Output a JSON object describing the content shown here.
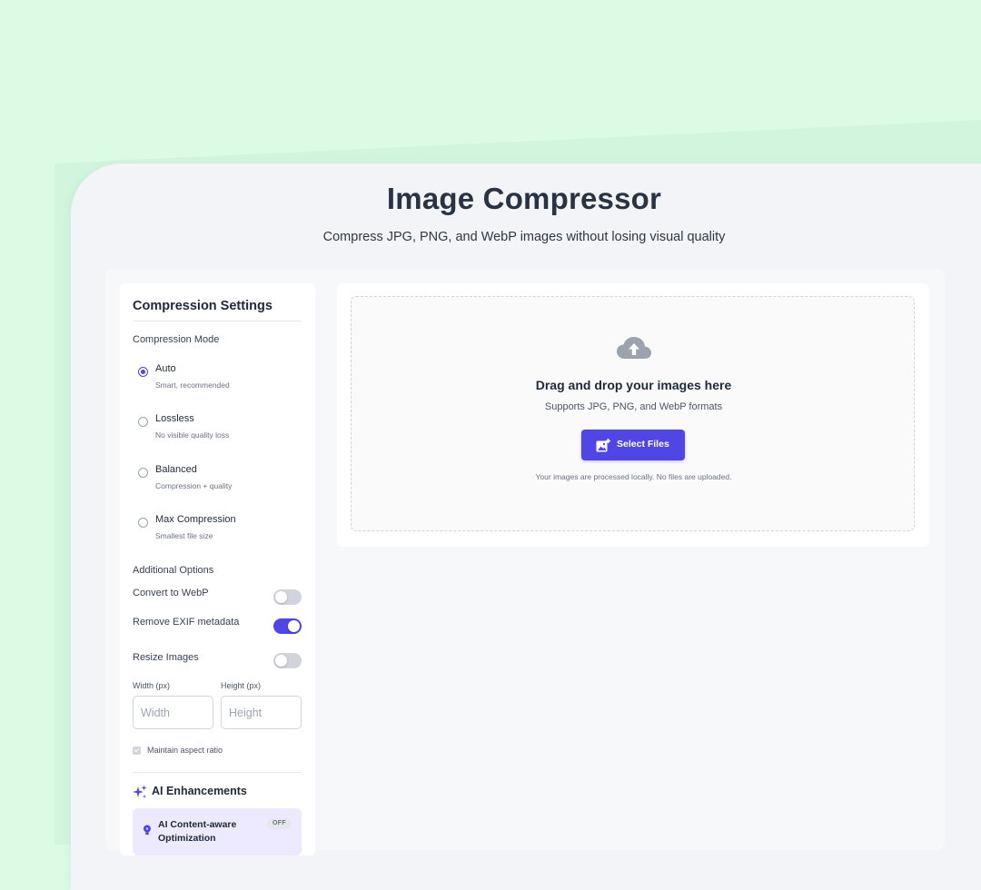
{
  "header": {
    "title": "Image Compressor",
    "subtitle": "Compress JPG, PNG, and WebP images without losing visual quality"
  },
  "colors": {
    "accent": "#4f46e5",
    "background": "#dcfbe4",
    "window": "#f3f4f7"
  },
  "sidebar": {
    "title": "Compression Settings",
    "mode_label": "Compression Mode",
    "modes": [
      {
        "label": "Auto",
        "desc": "Smart, recommended",
        "selected": true
      },
      {
        "label": "Lossless",
        "desc": "No visible quality loss",
        "selected": false
      },
      {
        "label": "Balanced",
        "desc": "Compression + quality",
        "selected": false
      },
      {
        "label": "Max Compression",
        "desc": "Smallest file size",
        "selected": false
      }
    ],
    "additional_label": "Additional Options",
    "options": [
      {
        "label": "Convert to WebP",
        "on": false
      },
      {
        "label": "Remove EXIF metadata",
        "on": true
      },
      {
        "label": "Resize Images",
        "on": false
      }
    ],
    "width_label": "Width (px)",
    "height_label": "Height (px)",
    "width_placeholder": "Width",
    "height_placeholder": "Height",
    "aspect_label": "Maintain aspect ratio",
    "aspect_checked": true,
    "ai_title": "AI Enhancements",
    "ai_icon": "sparkles-icon",
    "ai_option": {
      "label": "AI Content-aware Optimization",
      "status": "OFF",
      "icon": "lightbulb-icon"
    }
  },
  "upload": {
    "icon": "cloud-upload-icon",
    "title": "Drag and drop your images here",
    "formats": "Supports JPG, PNG, and WebP formats",
    "button_label": "Select Files",
    "button_icon": "add-image-icon",
    "note": "Your images are processed locally. No files are uploaded."
  }
}
